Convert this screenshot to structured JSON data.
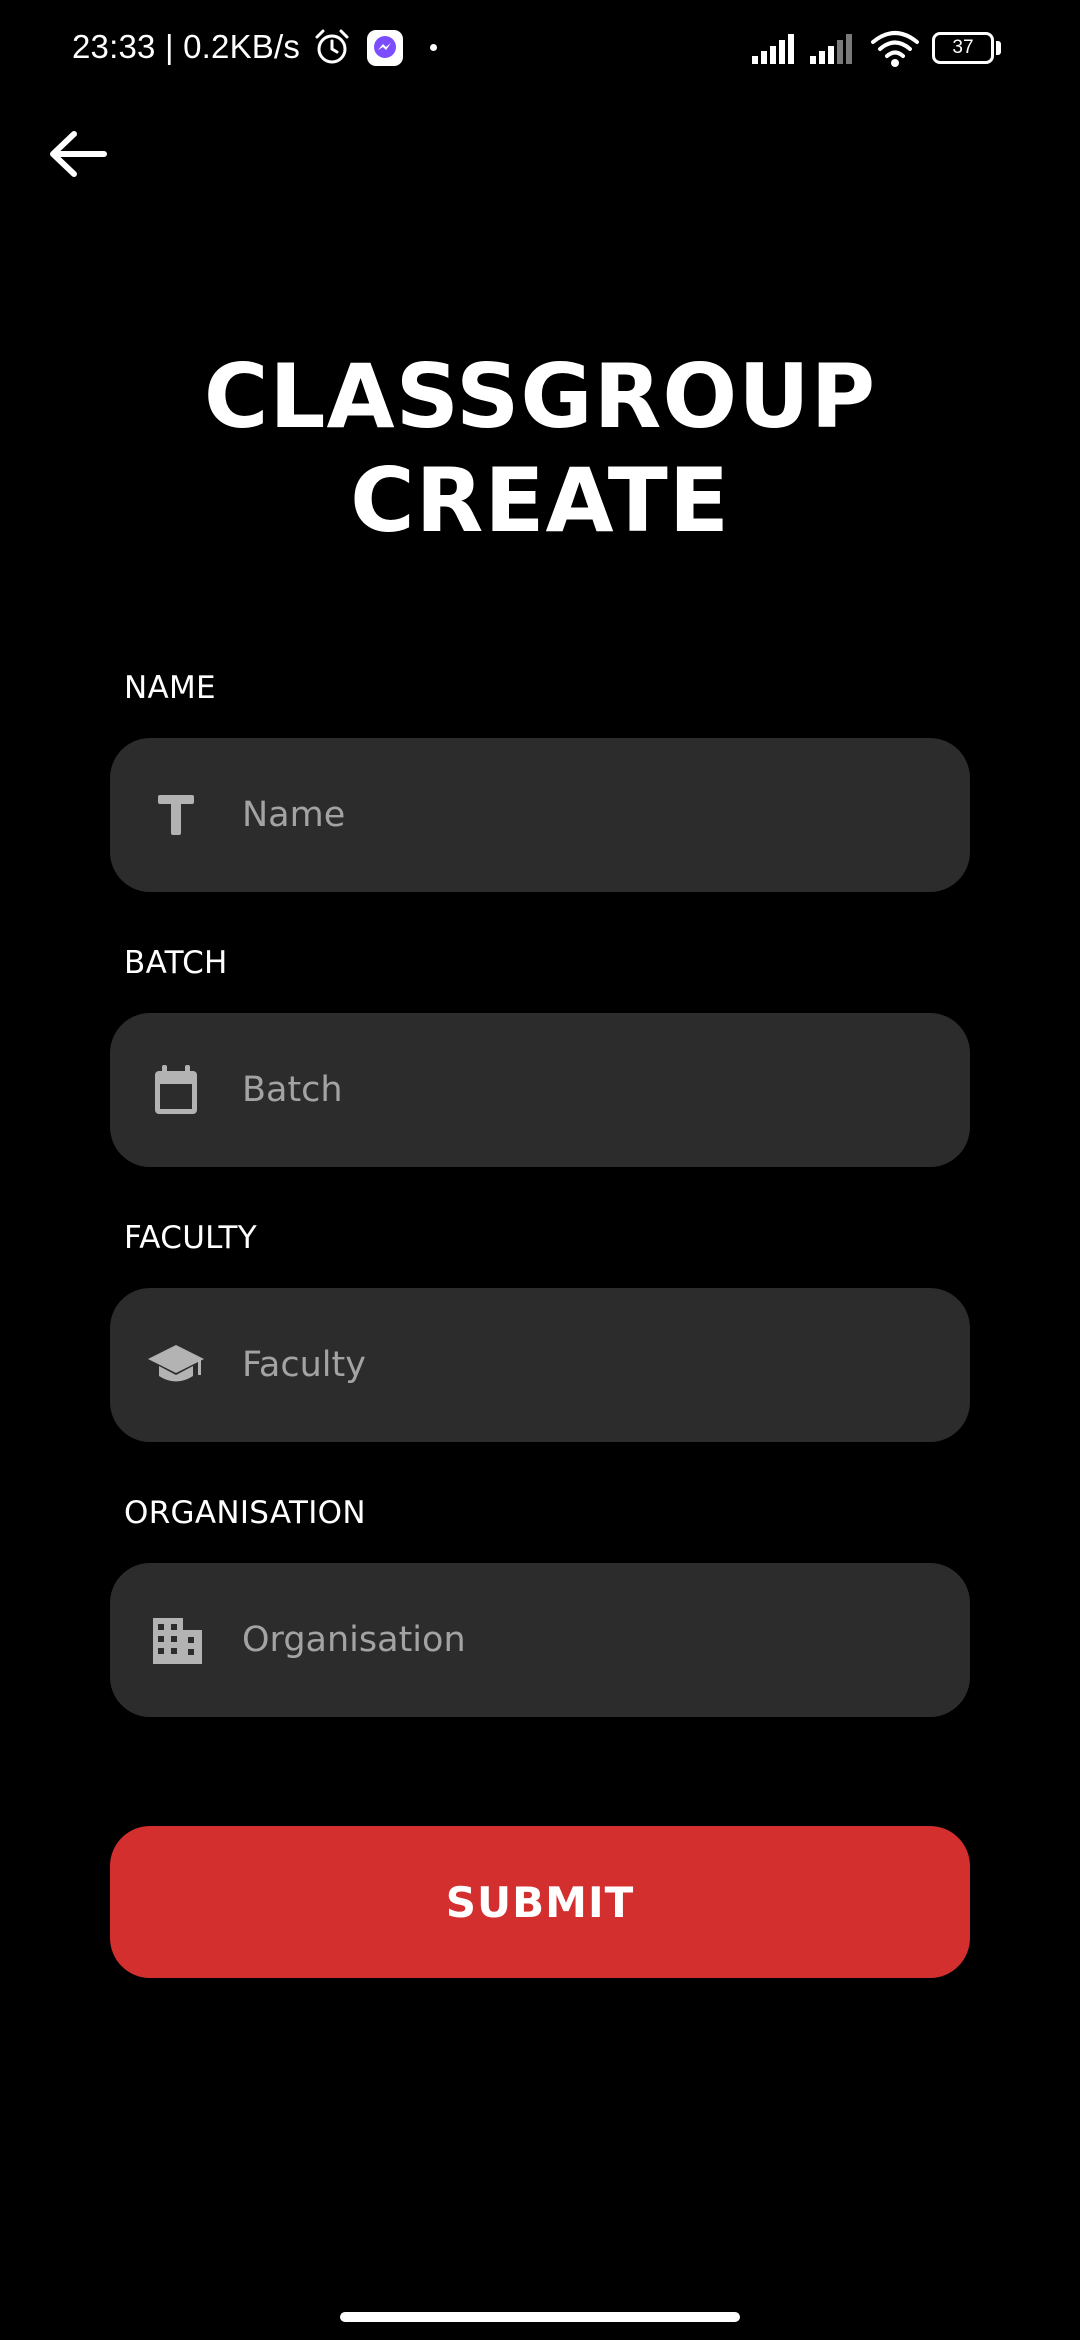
{
  "status_bar": {
    "time": "23:33 | 0.2KB/s",
    "battery": "37",
    "icons": [
      "alarm-icon",
      "messenger-icon",
      "signal-icon",
      "signal-icon",
      "wifi-icon",
      "battery-icon"
    ]
  },
  "header": {
    "back_icon": "arrow-left-icon",
    "title_line1": "CLASSGROUP",
    "title_line2": "CREATE"
  },
  "form": {
    "name": {
      "label": "NAME",
      "placeholder": "Name",
      "value": "",
      "icon": "text-icon"
    },
    "batch": {
      "label": "BATCH",
      "placeholder": "Batch",
      "value": "",
      "icon": "calendar-icon"
    },
    "faculty": {
      "label": "FACULTY",
      "placeholder": "Faculty",
      "value": "",
      "icon": "graduation-cap-icon"
    },
    "organisation": {
      "label": "ORGANISATION",
      "placeholder": "Organisation",
      "value": "",
      "icon": "building-icon"
    }
  },
  "submit": {
    "label": "SUBMIT"
  },
  "colors": {
    "background": "#000000",
    "field_background": "#2c2c2c",
    "placeholder": "#a3a3a3",
    "icon": "#b3b3b3",
    "accent": "#d32f2f",
    "text": "#ffffff"
  }
}
